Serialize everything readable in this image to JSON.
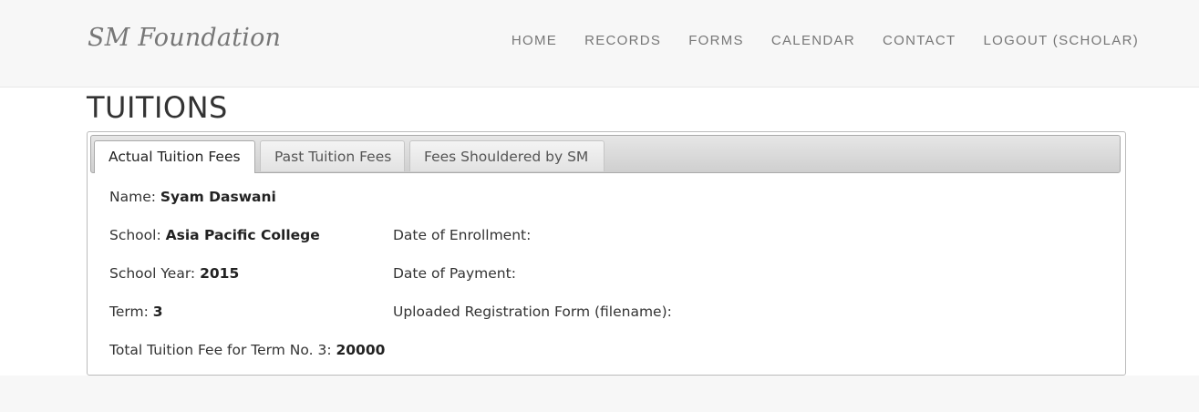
{
  "brand": "SM Foundation",
  "nav": [
    "HOME",
    "RECORDS",
    "FORMS",
    "CALENDAR",
    "CONTACT",
    "LOGOUT (SCHOLAR)"
  ],
  "page_title": "TUITIONS",
  "tabs": [
    "Actual Tuition Fees",
    "Past Tuition Fees",
    "Fees Shouldered by SM"
  ],
  "details": {
    "name_label": "Name:",
    "name_value": "Syam Daswani",
    "school_label": "School:",
    "school_value": "Asia Pacific College",
    "year_label": "School Year:",
    "year_value": "2015",
    "term_label": "Term:",
    "term_value": "3",
    "total_label": "Total Tuition Fee for Term No. 3:",
    "total_value": "20000",
    "enrollment_label": "Date of Enrollment:",
    "payment_label": "Date of Payment:",
    "upload_label": "Uploaded Registration Form (filename):"
  }
}
